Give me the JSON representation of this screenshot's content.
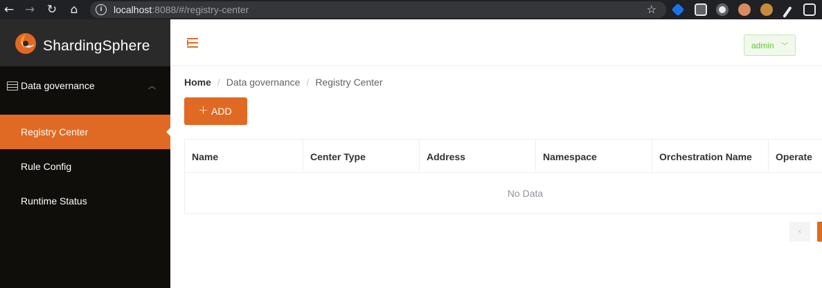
{
  "browser": {
    "url_host": "localhost",
    "url_rest": ":8088/#/registry-center"
  },
  "app": {
    "logo_text": "ShardingSphere",
    "brand_color": "#e06a23"
  },
  "sidebar": {
    "group_label": "Data governance",
    "items": [
      {
        "label": "Registry Center",
        "active": true
      },
      {
        "label": "Rule Config",
        "active": false
      },
      {
        "label": "Runtime Status",
        "active": false
      }
    ]
  },
  "header": {
    "user_label": "admin"
  },
  "breadcrumb": {
    "items": [
      "Home",
      "Data governance",
      "Registry Center"
    ]
  },
  "toolbar": {
    "add_label": "ADD"
  },
  "table": {
    "columns": [
      "Name",
      "Center Type",
      "Address",
      "Namespace",
      "Orchestration Name",
      "Operate"
    ],
    "empty_text": "No Data"
  },
  "pagination": {
    "prev_icon": "chevron-left-icon"
  }
}
